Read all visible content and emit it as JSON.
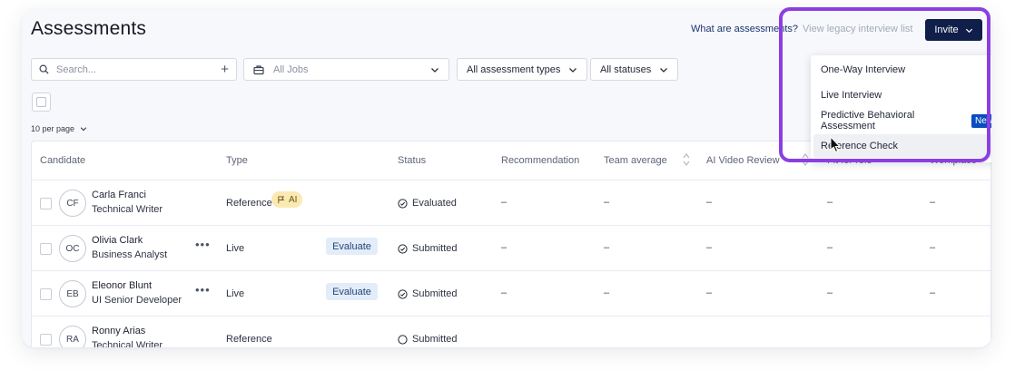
{
  "header": {
    "title": "Assessments",
    "what_link": "What are assessments?",
    "legacy_link": "View legacy interview list",
    "invite_label": "Invite"
  },
  "filters": {
    "search_placeholder": "Search...",
    "jobs_placeholder": "All Jobs",
    "types_label": "All assessment types",
    "statuses_label": "All statuses"
  },
  "pagination": {
    "per_page_label": "10 per page"
  },
  "table": {
    "columns": [
      "Candidate",
      "Type",
      "Status",
      "Recommendation",
      "Team average",
      "AI Video Review",
      "Fit for role",
      "Workplace"
    ],
    "rows": [
      {
        "initials": "CF",
        "name": "Carla Franci",
        "role": "Technical Writer",
        "type": "Reference",
        "tag": "AI",
        "action": "",
        "status": "Evaluated",
        "status_icon": "check-circle-icon",
        "recommendation": "–",
        "team_average": "–",
        "ai_video_review": "–",
        "fit_for_role": "–",
        "workplace": "–"
      },
      {
        "initials": "OC",
        "name": "Olivia Clark",
        "role": "Business Analyst",
        "type": "Live",
        "tag": "",
        "action": "Evaluate",
        "status": "Submitted",
        "status_icon": "check-circle-icon",
        "recommendation": "–",
        "team_average": "–",
        "ai_video_review": "–",
        "fit_for_role": "–",
        "workplace": "–"
      },
      {
        "initials": "EB",
        "name": "Eleonor Blunt",
        "role": "UI Senior Developer",
        "type": "Live",
        "tag": "",
        "action": "Evaluate",
        "status": "Submitted",
        "status_icon": "check-circle-icon",
        "recommendation": "–",
        "team_average": "–",
        "ai_video_review": "–",
        "fit_for_role": "–",
        "workplace": "–"
      },
      {
        "initials": "RA",
        "name": "Ronny Arias",
        "role": "Technical Writer",
        "type": "Reference",
        "tag": "",
        "action": "",
        "status": "Submitted",
        "status_icon": "empty-circle-icon",
        "recommendation": "–",
        "team_average": "–",
        "ai_video_review": "–",
        "fit_for_role": "–",
        "workplace": "–"
      }
    ]
  },
  "invite_menu": {
    "items": [
      {
        "label": "One-Way Interview",
        "badge": ""
      },
      {
        "label": "Live Interview",
        "badge": ""
      },
      {
        "label": "Predictive Behavioral Assessment",
        "badge": "New"
      },
      {
        "label": "Reference Check",
        "badge": ""
      }
    ]
  },
  "colors": {
    "primary_button": "#0f1f4a",
    "highlight_border": "#8b3fe0",
    "new_badge": "#0a4dbf",
    "ai_tag": "#fbe9b3",
    "evaluate_button": "#e3edf9"
  }
}
